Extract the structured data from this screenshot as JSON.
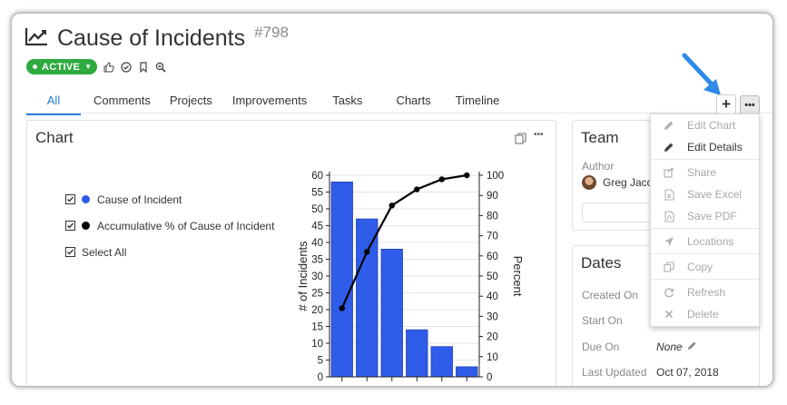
{
  "header": {
    "title": "Cause of Incidents",
    "id": "#798",
    "status": "ACTIVE"
  },
  "tabs": [
    "All",
    "Comments",
    "Projects",
    "Improvements",
    "Tasks",
    "Charts",
    "Timeline"
  ],
  "selected_tab": "All",
  "chart_card": {
    "title": "Chart",
    "legend": [
      {
        "label": "Cause of Incident",
        "color": "#2f5ce8"
      },
      {
        "label": "Accumulative % of Cause of Incident",
        "color": "#000000"
      },
      {
        "label": "Select All"
      }
    ]
  },
  "chart_data": {
    "type": "bar",
    "categories": [
      "",
      "",
      "",
      "",
      "",
      ""
    ],
    "series": [
      {
        "name": "Cause of Incident",
        "type": "bar",
        "values": [
          58,
          47,
          38,
          14,
          9,
          3
        ],
        "axis": "left"
      },
      {
        "name": "Accumulative % of Cause of Incident",
        "type": "line",
        "values": [
          34,
          62,
          85,
          93,
          98,
          100
        ],
        "axis": "right"
      }
    ],
    "ylabel": "# of Incidents",
    "y2label": "Percent",
    "ylim": [
      0,
      60
    ],
    "y2lim": [
      0,
      100
    ],
    "yticks": [
      "0",
      "5",
      "10",
      "15",
      "20",
      "25",
      "30",
      "35",
      "40",
      "45",
      "50",
      "55",
      "60"
    ],
    "y2ticks": [
      "0",
      "10",
      "20",
      "30",
      "40",
      "50",
      "60",
      "70",
      "80",
      "90",
      "100"
    ],
    "bar_color": "#2f5ce8",
    "grid": true
  },
  "team": {
    "title": "Team",
    "author_label": "Author",
    "author_name": "Greg Jaco"
  },
  "dates": {
    "title": "Dates",
    "rows": [
      {
        "label": "Created On",
        "value": ""
      },
      {
        "label": "Start On",
        "value": ""
      },
      {
        "label": "Due On",
        "value": "None"
      },
      {
        "label": "Last Updated",
        "value": "Oct 07, 2018"
      }
    ]
  },
  "menu": {
    "items": [
      {
        "label": "Edit Chart",
        "icon": "pencil-icon",
        "enabled": false
      },
      {
        "label": "Edit Details",
        "icon": "pencil-icon",
        "enabled": true
      },
      {
        "label": "Share",
        "icon": "share-icon",
        "enabled": false
      },
      {
        "label": "Save Excel",
        "icon": "excel-file-icon",
        "enabled": false
      },
      {
        "label": "Save PDF",
        "icon": "pdf-file-icon",
        "enabled": false
      },
      {
        "label": "Locations",
        "icon": "location-arrow-icon",
        "enabled": false
      },
      {
        "label": "Copy",
        "icon": "copy-icon",
        "enabled": false
      },
      {
        "label": "Refresh",
        "icon": "refresh-icon",
        "enabled": false
      },
      {
        "label": "Delete",
        "icon": "close-icon",
        "enabled": false
      }
    ]
  },
  "colors": {
    "accent": "#2a7de1",
    "active": "#2eaa3f",
    "arrow": "#2d8ae8"
  }
}
